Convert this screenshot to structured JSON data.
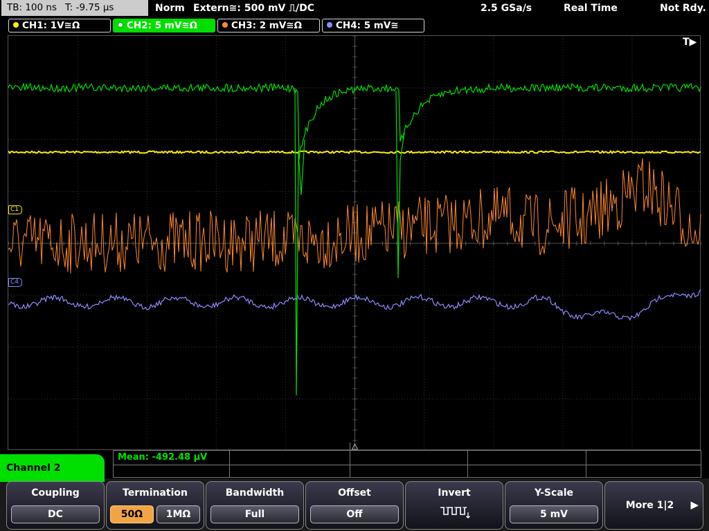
{
  "status": {
    "timebase": "TB: 100 ns",
    "trigger_time": "T: -9.75 µs",
    "trigger_mode": "Norm",
    "trigger_source": "Extern≅: 500 mV ⎍/DC",
    "sample_rate": "2.5 GSa/s",
    "acq_mode": "Real Time",
    "acq_state": "Not Rdy."
  },
  "channels": [
    {
      "label": "CH1: 1V≅Ω",
      "color": "#ffee00",
      "active": false
    },
    {
      "label": "CH2: 5 mV≅Ω",
      "color": "#00e000",
      "active": true
    },
    {
      "label": "CH3: 2 mV≅Ω",
      "color": "#ff8a2a",
      "active": false
    },
    {
      "label": "CH4: 5 mV≅",
      "color": "#8c8cff",
      "active": false
    }
  ],
  "markers": {
    "c1": "C1",
    "c4": "C4"
  },
  "trigger_indicator": "T▶",
  "measurement": {
    "mean": "Mean: -492.48 µV"
  },
  "menu": {
    "title": "Channel 2",
    "coupling": {
      "label": "Coupling",
      "value": "DC"
    },
    "termination": {
      "label": "Termination",
      "opt1": "50Ω",
      "opt2": "1MΩ",
      "selected": "50Ω"
    },
    "bandwidth": {
      "label": "Bandwidth",
      "value": "Full"
    },
    "offset": {
      "label": "Offset",
      "value": "Off"
    },
    "invert": {
      "label": "Invert"
    },
    "yscale": {
      "label": "Y-Scale",
      "value": "5 mV"
    },
    "more": {
      "label": "More 1|2",
      "arrow": "▶"
    }
  },
  "icons": {
    "trigger_arrow": "triangle-right",
    "invert": "inverted-square-wave"
  }
}
